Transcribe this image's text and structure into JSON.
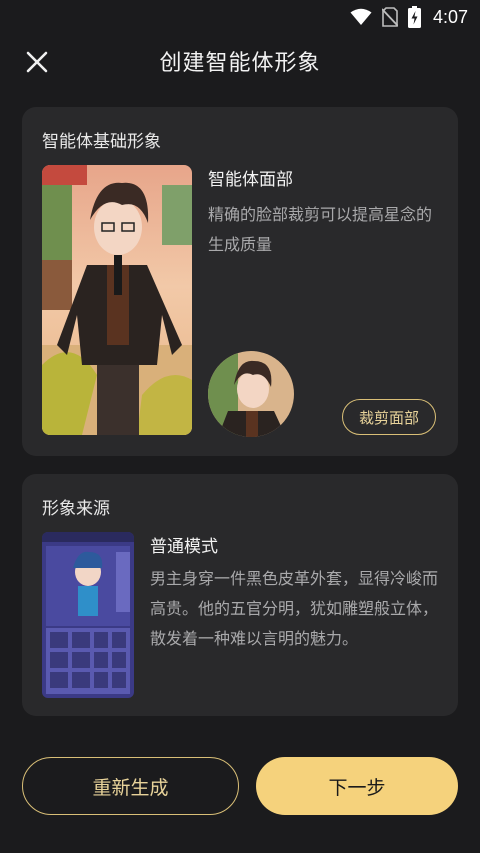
{
  "status_bar": {
    "time": "4:07",
    "icons": [
      "wifi-icon",
      "no-sim-icon",
      "battery-charging-icon"
    ]
  },
  "header": {
    "title": "创建智能体形象",
    "close_icon": "close-icon"
  },
  "base_image": {
    "section_title": "智能体基础形象",
    "face_title": "智能体面部",
    "face_description": "精确的脸部裁剪可以提高星念的生成质量",
    "crop_button_label": "裁剪面部"
  },
  "image_source": {
    "section_title": "形象来源",
    "mode_title": "普通模式",
    "mode_description": "男主身穿一件黑色皮革外套，显得冷峻而高贵。他的五官分明，犹如雕塑般立体，散发着一种难以言明的魅力。"
  },
  "actions": {
    "regenerate_label": "重新生成",
    "next_label": "下一步"
  },
  "colors": {
    "background": "#1b1b1d",
    "card": "#29292b",
    "accent": "#f5d27c",
    "accent_border": "#d9bf77"
  }
}
